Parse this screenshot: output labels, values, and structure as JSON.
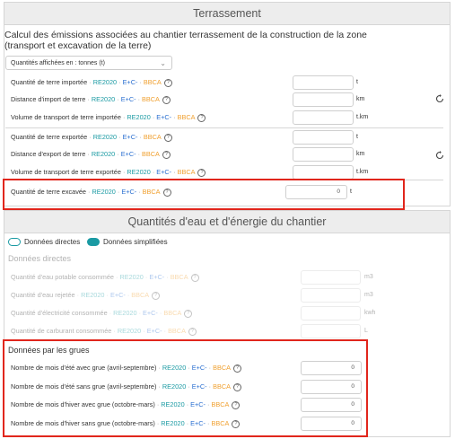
{
  "terrassement": {
    "title": "Terrassement",
    "intro": "Calcul des émissions associées au chantier terrassement de la construction de la zone (transport et excavation de la terre)",
    "select_value": "Quantités affichées en : tonnes (t)",
    "tags": {
      "re2020": "RE2020",
      "ec": "E+C-",
      "bbca": "BBCA",
      "sep": "·"
    },
    "rows": [
      {
        "label": "Quantité de terre importée",
        "unit": "t",
        "value": ""
      },
      {
        "label": "Distance d'import de terre",
        "unit": "km",
        "value": ""
      },
      {
        "label": "Volume de transport de terre importée",
        "unit": "t.km",
        "value": ""
      },
      {
        "label": "Quantité de terre exportée",
        "unit": "t",
        "value": ""
      },
      {
        "label": "Distance d'export de terre",
        "unit": "km",
        "value": ""
      },
      {
        "label": "Volume de transport de terre exportée",
        "unit": "t.km",
        "value": ""
      },
      {
        "label": "Quantité de terre excavée",
        "unit": "t",
        "value": "0"
      }
    ],
    "refresh_icon": "refresh-icon",
    "help_icon": "help-icon",
    "help_glyph": "?"
  },
  "eau_energie": {
    "title": "Quantités d'eau et d'énergie du chantier",
    "toggle_direct": "Données directes",
    "toggle_simplified": "Données simplifiées",
    "direct_title": "Données directes",
    "direct_rows": [
      {
        "label": "Quantité d'eau potable consommée",
        "unit": "m3",
        "value": ""
      },
      {
        "label": "Quantité d'eau rejetée",
        "unit": "m3",
        "value": ""
      },
      {
        "label": "Quantité d'électricité consommée",
        "unit": "kwh",
        "value": ""
      },
      {
        "label": "Quantité de carburant consommée",
        "unit": "L",
        "value": ""
      }
    ],
    "grues_title": "Données par les grues",
    "grues_rows": [
      {
        "label": "Nombre de mois d'été avec grue (avril-septembre)",
        "value": "0"
      },
      {
        "label": "Nombre de mois d'été sans grue (avril-septembre)",
        "value": "0"
      },
      {
        "label": "Nombre de mois d'hiver avec grue (octobre-mars)",
        "value": "0"
      },
      {
        "label": "Nombre de mois d'hiver sans grue (octobre-mars)",
        "value": "0"
      }
    ],
    "colors": {
      "accent": "#1a9aa3",
      "highlight": "#e1261c"
    }
  }
}
